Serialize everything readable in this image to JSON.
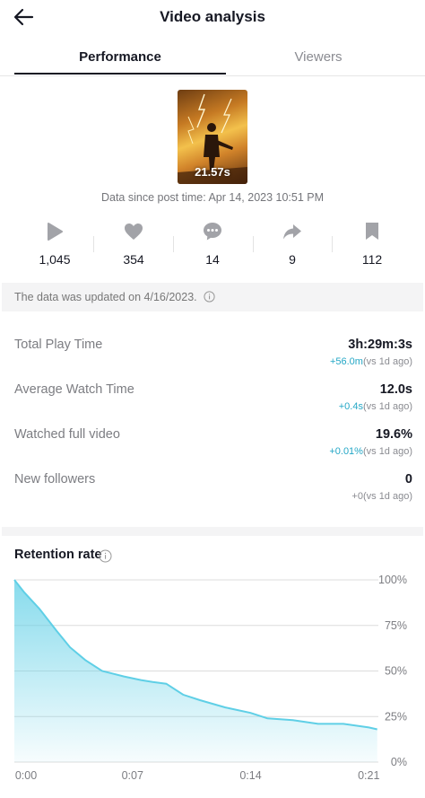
{
  "header": {
    "title": "Video analysis",
    "back_icon": "arrow-left-icon"
  },
  "tabs": [
    {
      "label": "Performance",
      "active": true
    },
    {
      "label": "Viewers",
      "active": false
    }
  ],
  "video": {
    "duration": "21.57s",
    "since": "Data since post time: Apr 14, 2023 10:51 PM"
  },
  "stats": [
    {
      "icon": "play-icon",
      "value": "1,045"
    },
    {
      "icon": "heart-icon",
      "value": "354"
    },
    {
      "icon": "comment-icon",
      "value": "14"
    },
    {
      "icon": "share-icon",
      "value": "9"
    },
    {
      "icon": "bookmark-icon",
      "value": "112"
    }
  ],
  "notice": "The data was updated on 4/16/2023.",
  "metrics": [
    {
      "label": "Total Play Time",
      "value": "3h:29m:3s",
      "change": "+56.0m",
      "suffix": "(vs 1d ago)"
    },
    {
      "label": "Average Watch Time",
      "value": "12.0s",
      "change": "+0.4s",
      "suffix": "(vs 1d ago)"
    },
    {
      "label": "Watched full video",
      "value": "19.6%",
      "change": "+0.01%",
      "suffix": "(vs 1d ago)"
    },
    {
      "label": "New followers",
      "value": "0",
      "change": "+0",
      "suffix": "(vs 1d ago)"
    }
  ],
  "retention": {
    "title": "Retention rate"
  },
  "colors": {
    "accent": "#24a7c6",
    "line": "#5fcfe6",
    "text": "#161823",
    "muted": "#8a8b91"
  },
  "chart_data": {
    "type": "area",
    "x_unit": "seconds",
    "x": [
      0,
      0.6,
      1.5,
      2.5,
      3.3,
      4.2,
      5.2,
      6.5,
      7.5,
      8.2,
      9.0,
      10.0,
      11.0,
      12.5,
      14.0,
      15.0,
      16.5,
      18.0,
      19.5,
      21.0,
      21.5
    ],
    "values": [
      100,
      93,
      84,
      72,
      63,
      56,
      50,
      47,
      45,
      44,
      43,
      37,
      34,
      30,
      27,
      24,
      23,
      21,
      21,
      19,
      18
    ],
    "x_ticks": [
      "0:00",
      "0:07",
      "0:14",
      "0:21"
    ],
    "x_tick_values": [
      0,
      7,
      14,
      21
    ],
    "y_ticks": [
      "100%",
      "75%",
      "50%",
      "25%",
      "0%"
    ],
    "y_tick_values": [
      100,
      75,
      50,
      25,
      0
    ],
    "xlim": [
      0,
      21.57
    ],
    "ylim": [
      0,
      100
    ],
    "grid": true
  }
}
